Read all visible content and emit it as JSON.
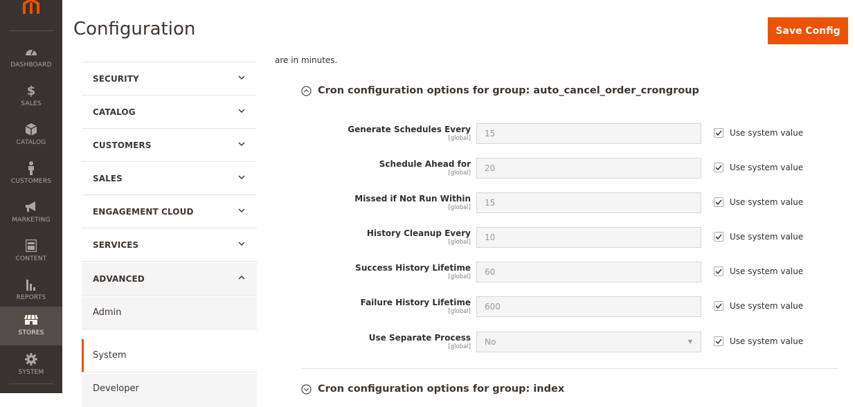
{
  "nav": {
    "items": [
      {
        "label": "DASHBOARD",
        "icon": "dashboard-icon"
      },
      {
        "label": "SALES",
        "icon": "dollar-icon"
      },
      {
        "label": "CATALOG",
        "icon": "cube-icon"
      },
      {
        "label": "CUSTOMERS",
        "icon": "person-icon"
      },
      {
        "label": "MARKETING",
        "icon": "megaphone-icon"
      },
      {
        "label": "CONTENT",
        "icon": "layout-icon"
      },
      {
        "label": "REPORTS",
        "icon": "bar-chart-icon"
      },
      {
        "label": "STORES",
        "icon": "store-icon"
      },
      {
        "label": "SYSTEM",
        "icon": "gear-icon"
      }
    ],
    "active": "STORES"
  },
  "header": {
    "title": "Configuration",
    "save_label": "Save Config"
  },
  "config_sidebar": {
    "sections": [
      {
        "label": "SECURITY"
      },
      {
        "label": "CATALOG"
      },
      {
        "label": "CUSTOMERS"
      },
      {
        "label": "SALES"
      },
      {
        "label": "ENGAGEMENT CLOUD"
      },
      {
        "label": "SERVICES"
      },
      {
        "label": "ADVANCED"
      }
    ],
    "sub_items": [
      {
        "label": "Admin"
      },
      {
        "label": "System"
      },
      {
        "label": "Developer"
      }
    ],
    "active_sub": "System"
  },
  "main": {
    "intro_text": "are in minutes.",
    "group_title": "Cron configuration options for group: auto_cancel_order_crongroup",
    "next_group_title": "Cron configuration options for group: index",
    "scope_label": "[global]",
    "use_system_label": "Use system value",
    "rows": [
      {
        "label": "Generate Schedules Every",
        "value": "15"
      },
      {
        "label": "Schedule Ahead for",
        "value": "20"
      },
      {
        "label": "Missed if Not Run Within",
        "value": "15"
      },
      {
        "label": "History Cleanup Every",
        "value": "10"
      },
      {
        "label": "Success History Lifetime",
        "value": "60"
      },
      {
        "label": "Failure History Lifetime",
        "value": "600"
      },
      {
        "label": "Use Separate Process",
        "value": "No"
      }
    ]
  },
  "colors": {
    "accent": "#eb5202",
    "nav_bg": "#373330",
    "nav_active": "#524d49"
  }
}
